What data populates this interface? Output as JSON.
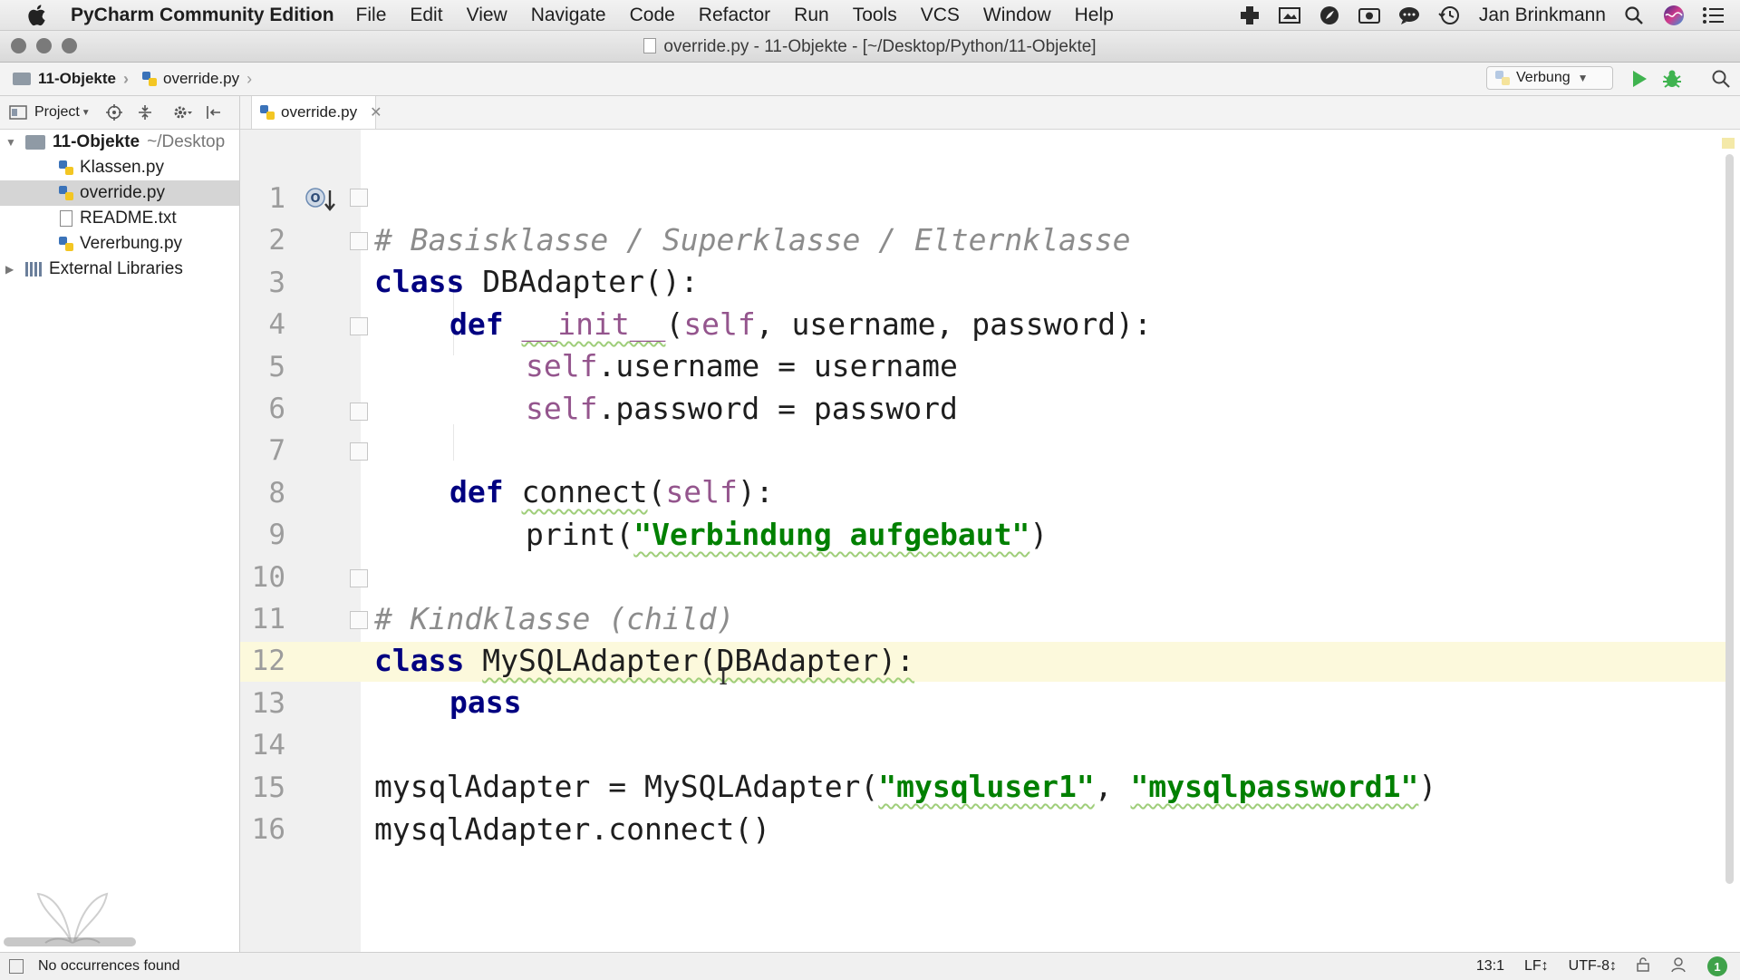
{
  "menubar": {
    "app_name": "PyCharm Community Edition",
    "menus": [
      "File",
      "Edit",
      "View",
      "Navigate",
      "Code",
      "Refactor",
      "Run",
      "Tools",
      "VCS",
      "Window",
      "Help"
    ],
    "user_name": "Jan Brinkmann"
  },
  "window": {
    "title": "override.py - 11-Objekte - [~/Desktop/Python/11-Objekte]"
  },
  "navbar": {
    "breadcrumb_project": "11-Objekte",
    "breadcrumb_file": "override.py",
    "run_config": "Verbung"
  },
  "project_panel": {
    "view_label": "Project",
    "root": {
      "name": "11-Objekte",
      "path": "~/Desktop"
    },
    "files": [
      "Klassen.py",
      "override.py",
      "README.txt",
      "Vererbung.py"
    ],
    "selected_file": "override.py",
    "external": "External Libraries"
  },
  "editor": {
    "tab_label": "override.py",
    "line_numbers": [
      "1",
      "2",
      "3",
      "4",
      "5",
      "6",
      "7",
      "8",
      "9",
      "10",
      "11",
      "12",
      "13",
      "14",
      "15",
      "16"
    ],
    "code": {
      "l1": "# Basisklasse / Superklasse / Elternklasse",
      "l2_kw": "class",
      "l2_rest": "DBAdapter():",
      "l3_kw": "def",
      "l3_fn": "__init__",
      "l3_open": "(",
      "l3_self": "self",
      "l3_rest": ", username, password):",
      "l4_self": "self",
      "l4_rest": ".username = username",
      "l5_self": "self",
      "l5_rest": ".password = password",
      "l7_kw": "def",
      "l7_fn": "connect",
      "l7_open": "(",
      "l7_self": "self",
      "l7_close": "):",
      "l8_fn": "print(",
      "l8_str": "\"Verbindung aufgebaut\"",
      "l8_close": ")",
      "l10": "# Kindklasse (child)",
      "l11_kw": "class",
      "l11_rest": "MySQLAdapter(DBAdapter):",
      "l12_kw": "pass",
      "l14_pre": "mysqlAdapter = MySQLAdapter(",
      "l14_str1": "\"mysqluser1\"",
      "l14_mid": ", ",
      "l14_str2": "\"mysqlpassword1\"",
      "l14_close": ")",
      "l15": "mysqlAdapter.connect()"
    }
  },
  "statusbar": {
    "message": "No occurrences found",
    "position": "13:1",
    "line_separator": "LF↕",
    "encoding": "UTF-8↕",
    "notifications": "1"
  },
  "colors": {
    "keyword": "#000080",
    "comment": "#8c8c8c",
    "string": "#008000",
    "self": "#94558d",
    "caret_line": "#fcf9dc"
  },
  "icons": [
    "apple-icon",
    "search-icon",
    "run-icon",
    "debug-icon",
    "close-icon",
    "folder-icon",
    "python-file-icon",
    "override-method-icon",
    "siri-icon",
    "notification-center-icon"
  ]
}
